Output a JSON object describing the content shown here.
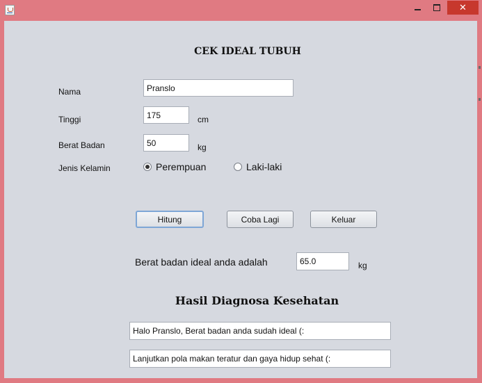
{
  "window": {
    "title_icon": "java-cup-icon",
    "controls": {
      "minimize": "minimize-icon",
      "maximize": "maximize-icon",
      "close": "close-icon"
    },
    "accent": "#e07a82",
    "close_color": "#c7382d",
    "client_background": "#d6d9e0"
  },
  "form": {
    "title": "CEK IDEAL TUBUH",
    "nama_label": "Nama",
    "nama_value": "Pranslo",
    "tinggi_label": "Tinggi",
    "tinggi_value": "175",
    "tinggi_unit": "cm",
    "berat_label": "Berat Badan",
    "berat_value": "50",
    "berat_unit": "kg",
    "kelamin_label": "Jenis Kelamin",
    "options": [
      {
        "label": "Perempuan",
        "selected": true
      },
      {
        "label": "Laki-laki",
        "selected": false
      }
    ]
  },
  "buttons": {
    "hitung": "Hitung",
    "coba_lagi": "Coba Lagi",
    "keluar": "Keluar"
  },
  "result": {
    "label": "Berat badan ideal anda adalah",
    "value": "65.0",
    "unit": "kg"
  },
  "diagnosis": {
    "title": "Hasil Diagnosa Kesehatan",
    "line1": "Halo Pranslo, Berat badan anda sudah ideal (:",
    "line2": "Lanjutkan pola makan teratur dan gaya hidup sehat (:"
  }
}
